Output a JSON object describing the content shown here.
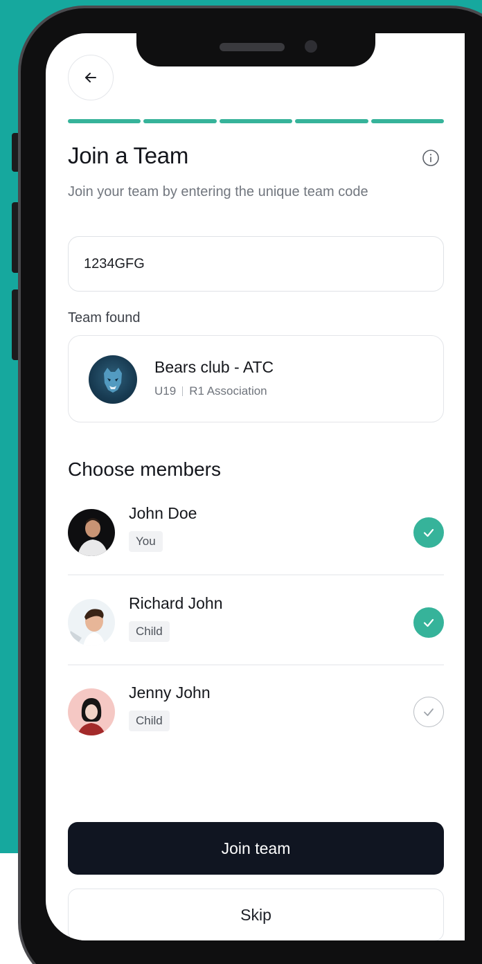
{
  "header": {
    "back_icon": "arrow-left-icon",
    "info_icon": "info-circle-icon",
    "progress_steps": 5,
    "progress_completed": 5
  },
  "page": {
    "title": "Join a Team",
    "subtitle": "Join your team by entering the unique team code"
  },
  "team_code": {
    "value": "1234GFG"
  },
  "team_found": {
    "label": "Team found",
    "name": "Bears club - ATC",
    "age_group": "U19",
    "association": "R1 Association",
    "logo_icon": "bear-crest-icon"
  },
  "members": {
    "title": "Choose members",
    "items": [
      {
        "name": "John Doe",
        "tag": "You",
        "selected": true
      },
      {
        "name": "Richard John",
        "tag": "Child",
        "selected": true
      },
      {
        "name": "Jenny John",
        "tag": "Child",
        "selected": false
      }
    ]
  },
  "actions": {
    "join_label": "Join team",
    "skip_label": "Skip"
  },
  "colors": {
    "background": "#16a89e",
    "accent": "#36b39a",
    "primary_button": "#101521",
    "phone_frame": "#0f0f10"
  }
}
